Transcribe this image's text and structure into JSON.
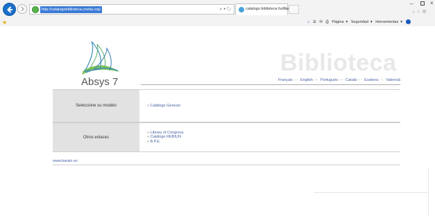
{
  "browser": {
    "url": "http://catalogobiblioteca.cnetia.org/",
    "address_tools": "⌕ ▾ ↻",
    "tab_title": "catalogo biblioteca fundaci...",
    "tab_close": "×",
    "window_min": "–",
    "window_close": "×",
    "top_icons": "⌂ ☆ ⚙",
    "favorites_icon": "★",
    "command_bar": {
      "page_label": "Página",
      "security_label": "Seguridad",
      "tools_label": "Herramientas"
    }
  },
  "page": {
    "logo_text": "Absys 7",
    "brand_title": "Biblioteca",
    "languages": [
      "Français",
      "English",
      "Português",
      "Català",
      "Euskera",
      "Valencià"
    ],
    "sections": [
      {
        "label": "Seleccione su modelo",
        "links": [
          "Catálogo General"
        ]
      },
      {
        "label": "Otros enlaces",
        "links": [
          "Library of Congress",
          "Catálogo REBIUN",
          "B.P.E."
        ]
      }
    ],
    "footer_link": "www.baratz.es"
  },
  "colors": {
    "link": "#4a62a5",
    "label_bg": "#e2e2e2",
    "brand_watermark": "#e8e8e8",
    "url_highlight": "#3a7bd5"
  }
}
